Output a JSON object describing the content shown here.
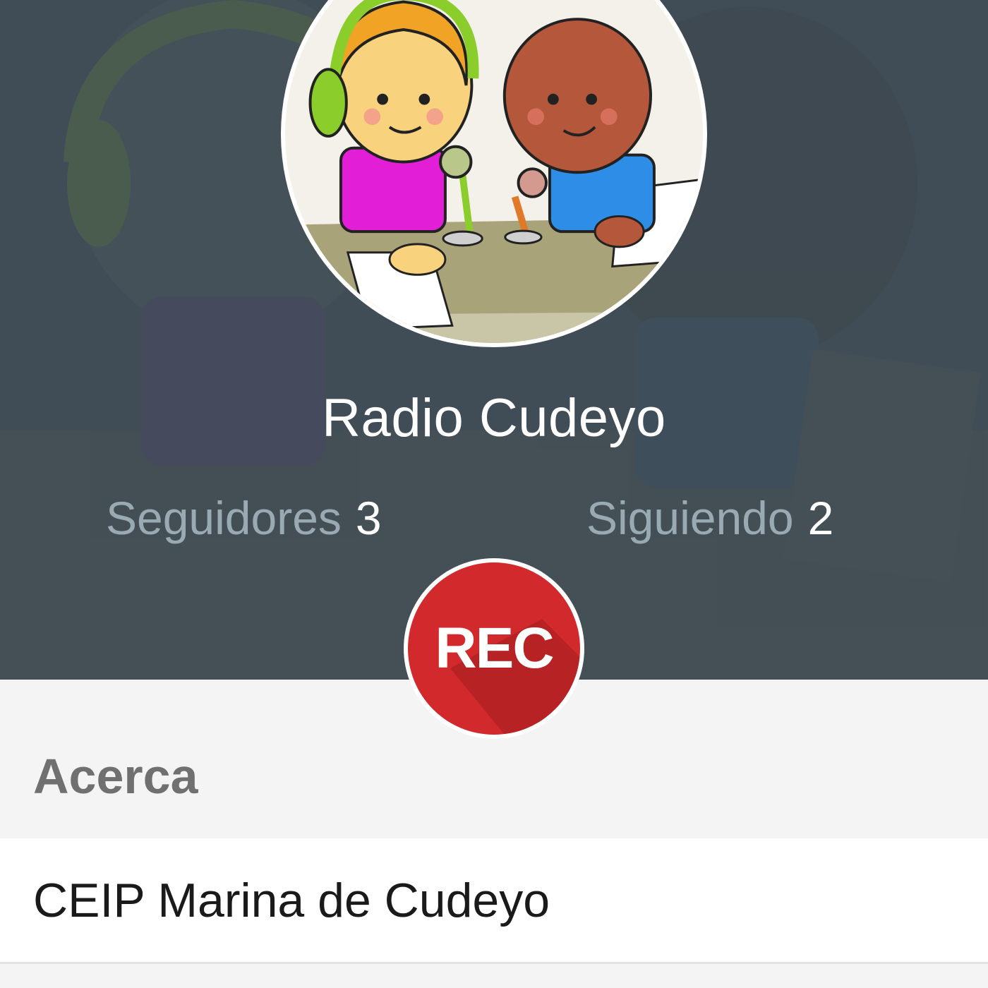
{
  "profile": {
    "name": "Radio Cudeyo",
    "avatar_icon": "kids-radio-microphones-illustration",
    "header_color": "#414d56"
  },
  "stats": {
    "followers_label": "Seguidores",
    "followers_count": "3",
    "following_label": "Siguiendo",
    "following_count": "2"
  },
  "rec_button": {
    "label": "REC",
    "color": "#d22a2c"
  },
  "about": {
    "title": "Acerca",
    "text": "CEIP Marina de Cudeyo"
  }
}
